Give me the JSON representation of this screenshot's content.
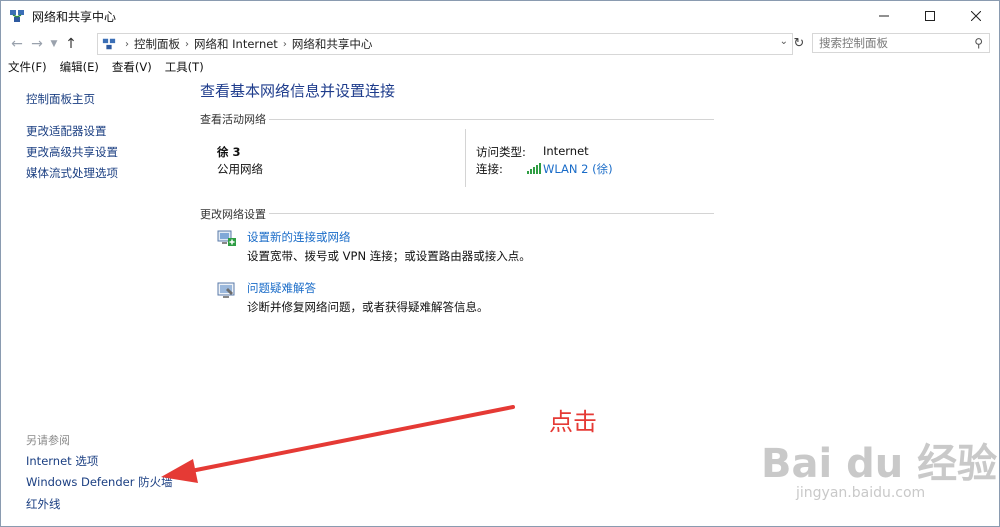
{
  "window": {
    "title": "网络和共享中心"
  },
  "address": {
    "crumbs": [
      "控制面板",
      "网络和 Internet",
      "网络和共享中心"
    ]
  },
  "search": {
    "placeholder": "搜索控制面板"
  },
  "menu": [
    "文件(F)",
    "编辑(E)",
    "查看(V)",
    "工具(T)"
  ],
  "sidebar": {
    "items": [
      "控制面板主页",
      "更改适配器设置",
      "更改高级共享设置",
      "媒体流式处理选项"
    ],
    "see_also_label": "另请参阅",
    "see_also": [
      "Internet 选项",
      "Windows Defender 防火墙",
      "红外线"
    ]
  },
  "main": {
    "title": "查看基本网络信息并设置连接",
    "active_networks_label": "查看活动网络",
    "network": {
      "name": "徐 3",
      "type": "公用网络",
      "access_label": "访问类型:",
      "access_value": "Internet",
      "connection_label": "连接:",
      "connection_value": "WLAN 2 (徐)"
    },
    "change_settings_label": "更改网络设置",
    "tasks": [
      {
        "title": "设置新的连接或网络",
        "desc": "设置宽带、拨号或 VPN 连接；或设置路由器或接入点。"
      },
      {
        "title": "问题疑难解答",
        "desc": "诊断并修复网络问题，或者获得疑难解答信息。"
      }
    ]
  },
  "annotation": {
    "text": "点击",
    "color": "#e53a35"
  },
  "watermark": {
    "brand": "Bai du 经验",
    "url": "jingyan.baidu.com"
  }
}
